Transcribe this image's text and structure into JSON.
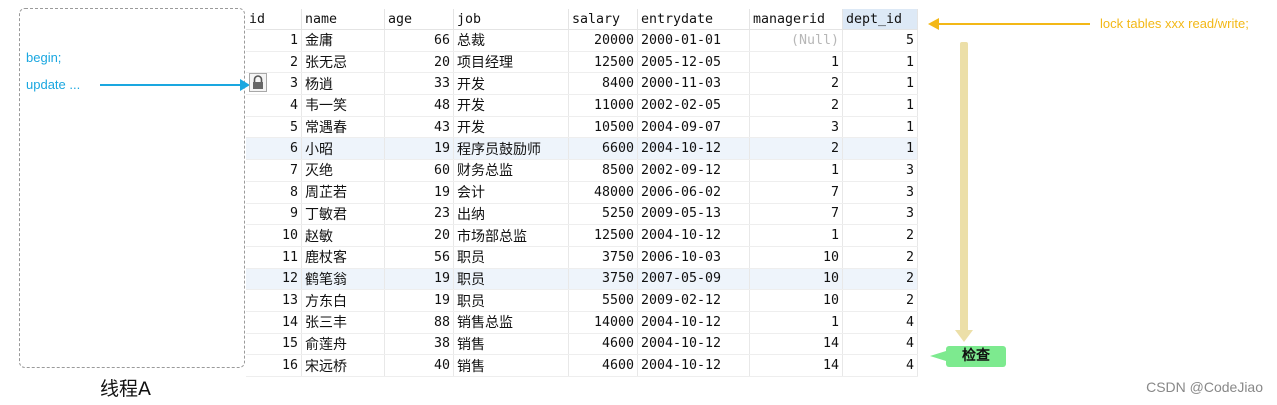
{
  "thread": {
    "label": "线程A",
    "steps": [
      "begin;",
      "update ..."
    ]
  },
  "annotation": {
    "lock_note": "lock tables xxx read/write;",
    "check_label": "检查"
  },
  "colors": {
    "thread_text": "#1aa7e0",
    "lock_note": "#f3b816",
    "check_badge": "#7dea8f",
    "header_highlight": "#dde9f6"
  },
  "icons": {
    "row_lock": "lock-icon"
  },
  "table": {
    "columns": [
      "id",
      "name",
      "age",
      "job",
      "salary",
      "entrydate",
      "managerid",
      "dept_id"
    ],
    "rows": [
      [
        "1",
        "金庸",
        "66",
        "总裁",
        "20000",
        "2000-01-01",
        "(Null)",
        "5"
      ],
      [
        "2",
        "张无忌",
        "20",
        "项目经理",
        "12500",
        "2005-12-05",
        "1",
        "1"
      ],
      [
        "3",
        "杨逍",
        "33",
        "开发",
        "8400",
        "2000-11-03",
        "2",
        "1"
      ],
      [
        "4",
        "韦一笑",
        "48",
        "开发",
        "11000",
        "2002-02-05",
        "2",
        "1"
      ],
      [
        "5",
        "常遇春",
        "43",
        "开发",
        "10500",
        "2004-09-07",
        "3",
        "1"
      ],
      [
        "6",
        "小昭",
        "19",
        "程序员鼓励师",
        "6600",
        "2004-10-12",
        "2",
        "1"
      ],
      [
        "7",
        "灭绝",
        "60",
        "财务总监",
        "8500",
        "2002-09-12",
        "1",
        "3"
      ],
      [
        "8",
        "周芷若",
        "19",
        "会计",
        "48000",
        "2006-06-02",
        "7",
        "3"
      ],
      [
        "9",
        "丁敏君",
        "23",
        "出纳",
        "5250",
        "2009-05-13",
        "7",
        "3"
      ],
      [
        "10",
        "赵敏",
        "20",
        "市场部总监",
        "12500",
        "2004-10-12",
        "1",
        "2"
      ],
      [
        "11",
        "鹿杖客",
        "56",
        "职员",
        "3750",
        "2006-10-03",
        "10",
        "2"
      ],
      [
        "12",
        "鹤笔翁",
        "19",
        "职员",
        "3750",
        "2007-05-09",
        "10",
        "2"
      ],
      [
        "13",
        "方东白",
        "19",
        "职员",
        "5500",
        "2009-02-12",
        "10",
        "2"
      ],
      [
        "14",
        "张三丰",
        "88",
        "销售总监",
        "14000",
        "2004-10-12",
        "1",
        "4"
      ],
      [
        "15",
        "俞莲舟",
        "38",
        "销售",
        "4600",
        "2004-10-12",
        "14",
        "4"
      ],
      [
        "16",
        "宋远桥",
        "40",
        "销售",
        "4600",
        "2004-10-12",
        "14",
        "4"
      ]
    ]
  },
  "watermark": "CSDN @CodeJiao"
}
